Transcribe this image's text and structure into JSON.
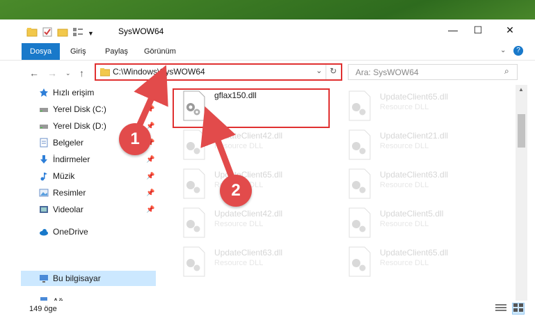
{
  "window": {
    "title": "SysWOW64"
  },
  "ribbon": {
    "tabs": [
      "Dosya",
      "Giriş",
      "Paylaş",
      "Görünüm"
    ]
  },
  "address": {
    "path": "C:\\Windows\\SysWOW64",
    "search_placeholder": "Ara: SysWOW64"
  },
  "sidebar": {
    "items": [
      {
        "label": "Hızlı erişim",
        "icon": "star-icon"
      },
      {
        "label": "Yerel Disk (C:)",
        "icon": "drive-icon"
      },
      {
        "label": "Yerel Disk (D:)",
        "icon": "drive-icon"
      },
      {
        "label": "Belgeler",
        "icon": "documents-icon"
      },
      {
        "label": "İndirmeler",
        "icon": "download-icon"
      },
      {
        "label": "Müzik",
        "icon": "music-icon"
      },
      {
        "label": "Resimler",
        "icon": "pictures-icon"
      },
      {
        "label": "Videolar",
        "icon": "videos-icon"
      },
      {
        "label": "OneDrive",
        "icon": "cloud-icon"
      },
      {
        "label": "Bu bilgisayar",
        "icon": "computer-icon"
      },
      {
        "label": "Ağ",
        "icon": "network-icon"
      }
    ]
  },
  "files": {
    "highlighted": {
      "name": "gflax150.dll"
    },
    "left_column": [
      {
        "name": "UpdateClient42.dll",
        "type": "Resource DLL"
      },
      {
        "name": "UpdateClient65.dll",
        "type": "Resource DLL"
      },
      {
        "name": "UpdateClient42.dll",
        "type": "Resource DLL"
      },
      {
        "name": "UpdateClient63.dll",
        "type": "Resource DLL"
      }
    ],
    "right_column": [
      {
        "name": "UpdateClient65.dll",
        "type": "Resource DLL"
      },
      {
        "name": "UpdateClient21.dll",
        "type": "Resource DLL"
      },
      {
        "name": "UpdateClient63.dll",
        "type": "Resource DLL"
      },
      {
        "name": "UpdateClient5.dll",
        "type": "Resource DLL"
      },
      {
        "name": "UpdateClient65.dll",
        "type": "Resource DLL"
      }
    ]
  },
  "status": {
    "count": "149 öge"
  },
  "badges": [
    "1",
    "2"
  ],
  "colors": {
    "accent": "#1979ca",
    "highlight": "#e03030",
    "selection": "#cce8ff"
  }
}
